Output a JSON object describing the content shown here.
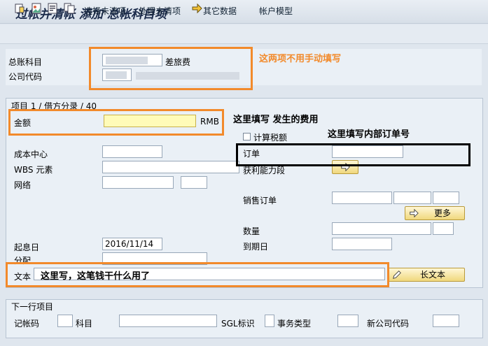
{
  "window": {
    "title": "过帐并清帐 添加 总帐科目项"
  },
  "toolbar": {
    "select_open": "选择未清项",
    "process_open": "处理未清项",
    "other_data": "其它数据",
    "account_model": "帐户模型"
  },
  "header": {
    "gl_account_label": "总账科目",
    "gl_account_desc": "差旅费",
    "company_code_label": "公司代码"
  },
  "item": {
    "group_title": "项目 1 / 借方分录 / 40",
    "amount_label": "金额",
    "amount_value": "",
    "currency": "RMB",
    "calc_tax_label": "计算税额",
    "cost_center_label": "成本中心",
    "order_label": "订单",
    "wbs_label": "WBS 元素",
    "profit_segment_label": "获利能力段",
    "network_label": "网络",
    "sales_order_label": "销售订单",
    "more_button": "更多",
    "quantity_label": "数量",
    "baseline_date_label": "起息日",
    "baseline_date_value": "2016/11/14",
    "due_date_label": "到期日",
    "assignment_label": "分配",
    "text_label": "文本",
    "long_text_button": "长文本"
  },
  "next_item": {
    "group_title": "下一行项目",
    "posting_key_label": "记帐码",
    "account_label": "科目",
    "sgl_label": "SGL标识",
    "trans_type_label": "事务类型",
    "new_company_label": "新公司代码"
  },
  "annotations": {
    "header_note": "这两项不用手动填写",
    "amount_note": "这里填写 发生的费用",
    "order_note": "这里填写内部订单号",
    "text_note": "这里写，这笔钱干什么用了"
  },
  "colors": {
    "annotation_orange": "#f28a2b",
    "required_field": "#fffbb8",
    "button_gold": "#f0d87d"
  }
}
